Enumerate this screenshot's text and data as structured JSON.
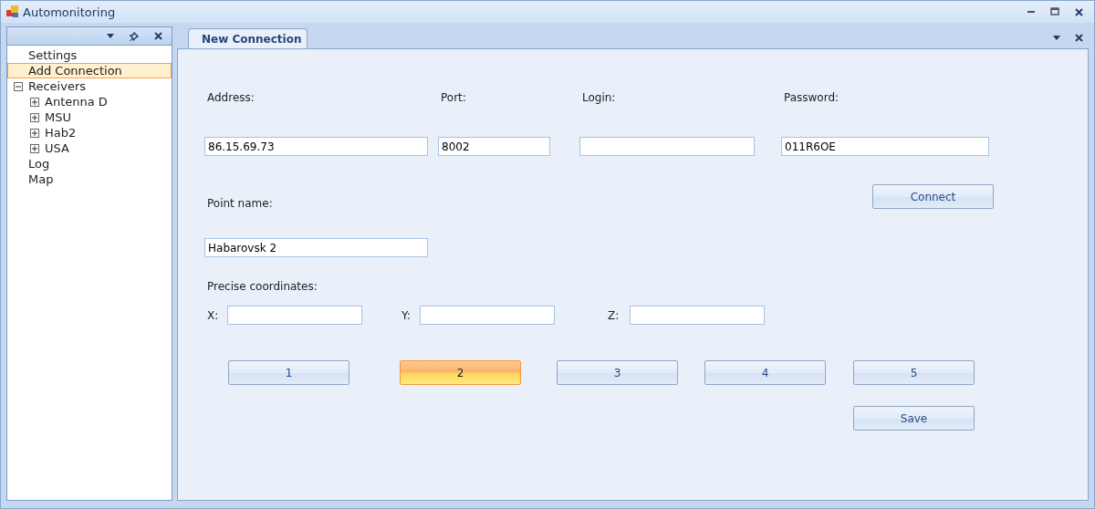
{
  "window": {
    "title": "Automonitoring"
  },
  "sidebar": {
    "items": [
      {
        "label": "Settings",
        "selected": false
      },
      {
        "label": "Add Connection",
        "selected": true
      },
      {
        "label": "Receivers",
        "selected": false,
        "expanded": true,
        "children": [
          {
            "label": "Antenna D",
            "selected": false,
            "expanded": false
          },
          {
            "label": "MSU",
            "selected": false,
            "expanded": false
          },
          {
            "label": "Hab2",
            "selected": false,
            "expanded": false
          },
          {
            "label": "USA",
            "selected": false,
            "expanded": false
          }
        ]
      },
      {
        "label": "Log",
        "selected": false
      },
      {
        "label": "Map",
        "selected": false
      }
    ]
  },
  "tabs": [
    {
      "label": "New Connection",
      "selected": true
    }
  ],
  "form": {
    "connection_fields": [
      {
        "label": "Address:",
        "value": "86.15.69.73"
      },
      {
        "label": "Port:",
        "value": "8002"
      },
      {
        "label": "Login:"
      },
      {
        "label": "Password:",
        "value": "011R6OE"
      }
    ],
    "connect_button": "Connect",
    "point_name": {
      "label": "Point name:",
      "value": "Habarovsk 2"
    },
    "coordinates_label": "Precise coordinates:",
    "coordinates": [
      {
        "label": "X:"
      },
      {
        "label": "Y:"
      },
      {
        "label": "Z:"
      }
    ],
    "page_buttons": [
      {
        "label": "1",
        "selected": false
      },
      {
        "label": "2",
        "selected": true
      },
      {
        "label": "3",
        "selected": false
      },
      {
        "label": "4",
        "selected": false
      },
      {
        "label": "5",
        "selected": false
      }
    ],
    "save_button": "Save"
  }
}
